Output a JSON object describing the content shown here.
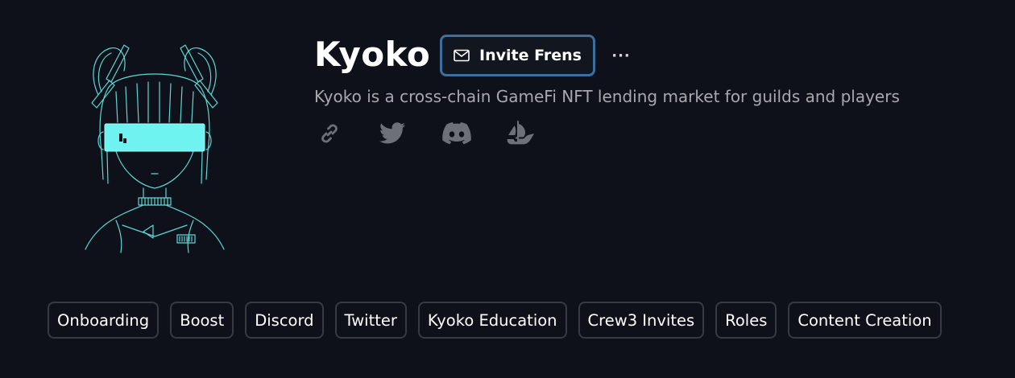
{
  "profile": {
    "name": "Kyoko",
    "description": "Kyoko is a cross-chain GameFi NFT lending market for guilds and players",
    "avatar_icon": "anime-girl-visor-avatar"
  },
  "actions": {
    "invite_label": "Invite Frens",
    "invite_icon": "mail-icon",
    "more_label": "···",
    "invite_border_color": "#3d6f9e"
  },
  "socials": [
    {
      "icon": "link-icon"
    },
    {
      "icon": "twitter-icon"
    },
    {
      "icon": "discord-icon"
    },
    {
      "icon": "opensea-icon"
    }
  ],
  "tags": [
    "Onboarding",
    "Boost",
    "Discord",
    "Twitter",
    "Kyoko Education",
    "Crew3 Invites",
    "Roles",
    "Content Creation"
  ],
  "colors": {
    "background": "#0e1119",
    "accent_cyan": "#6ff3f0",
    "muted_text": "#a7a9ae",
    "icon_gray": "#6d7078"
  }
}
